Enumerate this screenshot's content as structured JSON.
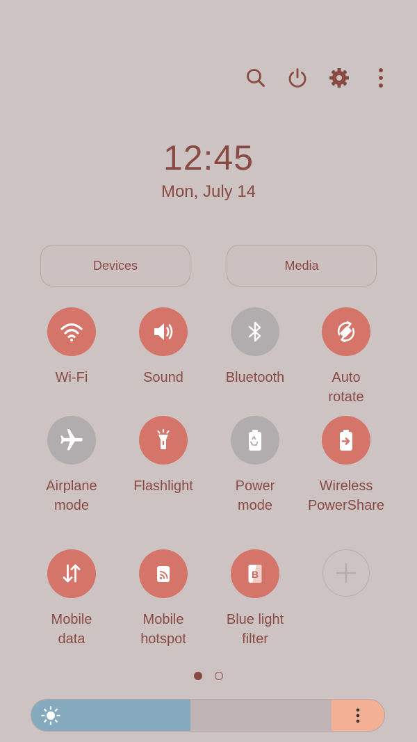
{
  "clock": {
    "time": "12:45",
    "date": "Mon, July 14"
  },
  "top_actions": [
    {
      "name": "search-icon",
      "icon": "search"
    },
    {
      "name": "power-icon",
      "icon": "power"
    },
    {
      "name": "settings-icon",
      "icon": "gear"
    },
    {
      "name": "more-options-icon",
      "icon": "more-vertical"
    }
  ],
  "pills": {
    "devices": "Devices",
    "media": "Media"
  },
  "tiles": [
    {
      "id": "wifi",
      "label": "Wi-Fi",
      "active": true,
      "icon": "wifi"
    },
    {
      "id": "sound",
      "label": "Sound",
      "active": true,
      "icon": "speaker"
    },
    {
      "id": "bluetooth",
      "label": "Bluetooth",
      "active": false,
      "icon": "bluetooth"
    },
    {
      "id": "auto-rotate",
      "label": "Auto\nrotate",
      "active": true,
      "icon": "rotate"
    },
    {
      "id": "airplane",
      "label": "Airplane\nmode",
      "active": false,
      "icon": "airplane"
    },
    {
      "id": "flashlight",
      "label": "Flashlight",
      "active": true,
      "icon": "flashlight"
    },
    {
      "id": "power-mode",
      "label": "Power\nmode",
      "active": false,
      "icon": "battery-recycle"
    },
    {
      "id": "wireless-powershare",
      "label": "Wireless\nPowerShare",
      "active": true,
      "icon": "battery-share"
    },
    {
      "id": "mobile-data",
      "label": "Mobile\ndata",
      "active": true,
      "icon": "arrows-up-down"
    },
    {
      "id": "mobile-hotspot",
      "label": "Mobile\nhotspot",
      "active": true,
      "icon": "hotspot"
    },
    {
      "id": "blue-light-filter",
      "label": "Blue light\nfilter",
      "active": true,
      "icon": "blue-light"
    }
  ],
  "add_tile": {
    "icon": "plus"
  },
  "pagination": {
    "current_page": 1,
    "total_pages": 2
  },
  "brightness": {
    "level_percent": 45,
    "icon": "sun",
    "menu_icon": "more-vertical"
  },
  "colors": {
    "background": "#cdc3c3",
    "accent": "#8a4a44",
    "tile_active": "#d57469",
    "tile_inactive": "#b1acad",
    "brightness_fill": "#86aabd",
    "brightness_end": "#f4b095"
  }
}
